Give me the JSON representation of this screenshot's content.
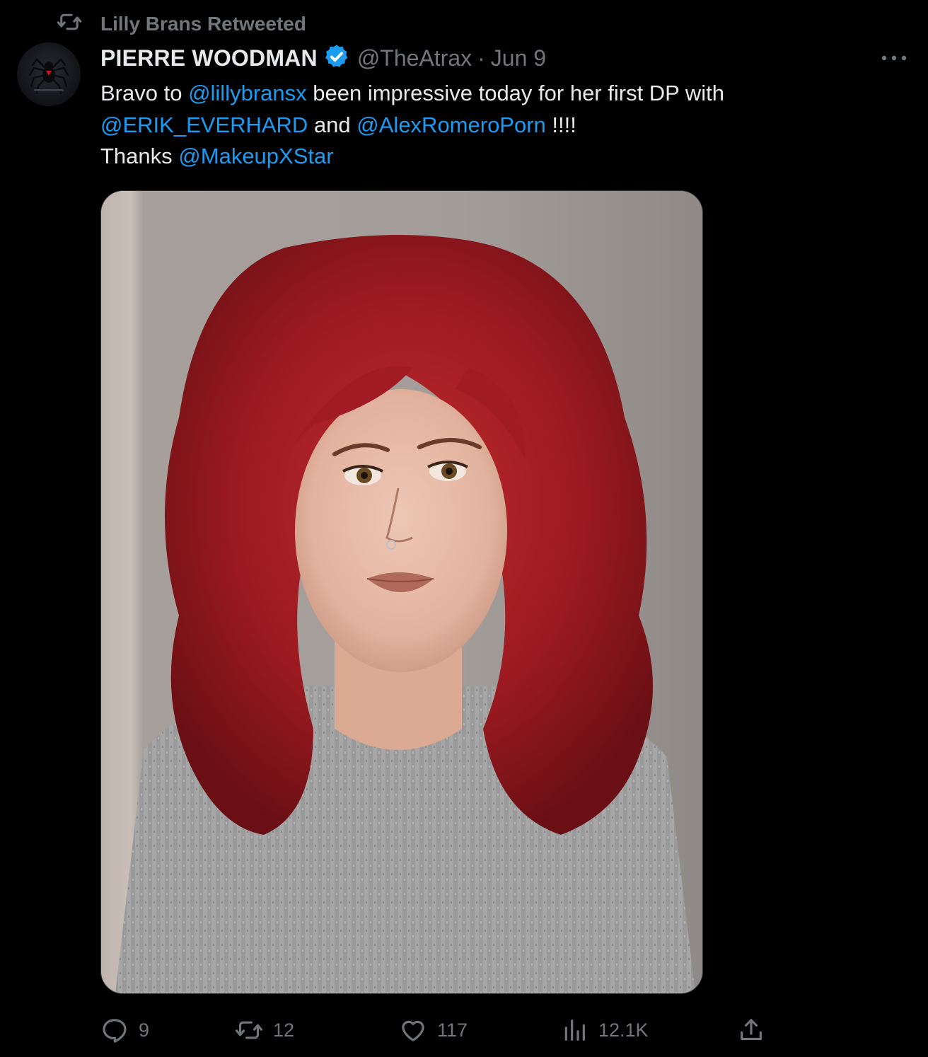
{
  "retweet_context": {
    "label": "Lilly Brans Retweeted",
    "icon": "retweet-icon"
  },
  "tweet": {
    "author": {
      "display_name": "PIERRE WOODMAN",
      "handle": "@TheAtrax",
      "verified": true,
      "verified_color": "#1d9bf0"
    },
    "separator": "·",
    "date": "Jun 9",
    "text": {
      "line1": {
        "a": "Bravo to ",
        "mention1": "@lillybransx",
        "b": " been impressive today for her first DP with"
      },
      "line2": {
        "mention2": "@ERIK_EVERHARD",
        "a": " and ",
        "mention3": "@AlexRomeroPorn",
        "b": " !!!!"
      },
      "line3": {
        "a": "Thanks ",
        "mention4": "@MakeupXStar"
      }
    },
    "media": {
      "kind": "photo",
      "subject": "portrait-with-red-curly-hair-grey-top"
    },
    "actions": {
      "replies": "9",
      "retweets": "12",
      "likes": "117",
      "views": "12.1K"
    }
  },
  "colors": {
    "background": "#000000",
    "text_primary": "#e7e9ea",
    "text_secondary": "#71767b",
    "accent": "#1d9bf0"
  }
}
